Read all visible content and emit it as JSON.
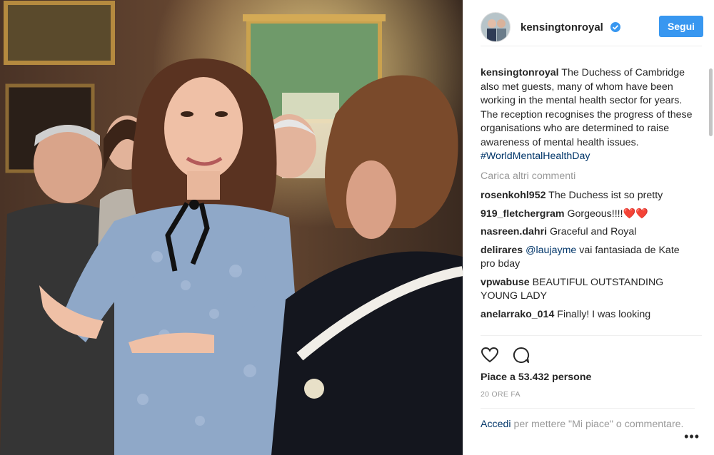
{
  "post": {
    "username": "kensingtonroyal",
    "follow_label": "Segui",
    "caption": {
      "username": "kensingtonroyal",
      "text": "The Duchess of Cambridge also met guests, many of whom have been working in the mental health sector for years. The reception recognises the progress of these organisations who are determined to raise awareness of mental health issues.",
      "hashtag": "#WorldMentalHealthDay"
    },
    "load_more": "Carica altri commenti",
    "comments": [
      {
        "user": "rosenkohl952",
        "text": "The Duchess ist so pretty"
      },
      {
        "user": "919_fletchergram",
        "text": "Gorgeous!!!!❤️❤️"
      },
      {
        "user": "nasreen.dahri",
        "text": "Graceful and Royal"
      },
      {
        "user": "delirares",
        "mention": "@laujayme",
        "text": "vai fantasiada de Kate pro bday"
      },
      {
        "user": "vpwabuse",
        "text": "BEAUTIFUL OUTSTANDING YOUNG LADY"
      },
      {
        "user": "anelarrako_014",
        "text": "Finally! I was looking"
      }
    ],
    "likes": "Piace a 53.432 persone",
    "time": "20 ORE FA",
    "login": {
      "link": "Accedi",
      "text": "per mettere \"Mi piace\" o commentare."
    },
    "more_options": "•••",
    "icons": {
      "like": "heart-icon",
      "comment": "comment-icon",
      "verified": "verified-badge-icon"
    },
    "colors": {
      "accent": "#3897f0",
      "link": "#003569",
      "muted": "#999999"
    }
  }
}
